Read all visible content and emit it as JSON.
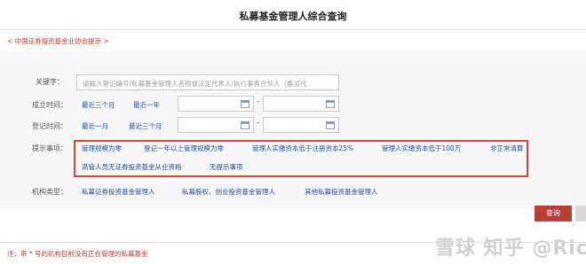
{
  "title": "私募基金管理人综合查询",
  "notice": "< 中国证券投资基金业协会提示 >",
  "keyword": {
    "label": "关键字：",
    "placeholder": "请输入登记编号/私募基金管理人名称或法定代表人/执行事务合伙人（委派代"
  },
  "established": {
    "label": "成立时间：",
    "opt1": "最近三个月",
    "opt2": "最近一年",
    "dash": "-"
  },
  "registered": {
    "label": "登记时间：",
    "opt1": "最近一月",
    "opt2": "最近三个月",
    "dash": "-"
  },
  "hints": {
    "label": "提示事项：",
    "items": [
      "管理规模为零",
      "登记一年以上管理规模为零",
      "管理人实缴资本低于注册资本25%",
      "管理人实缴资本低于100万",
      "非正常清算",
      "高管人员无证券投资基金从业资格",
      "无提示事项"
    ]
  },
  "org_type": {
    "label": "机构类型：",
    "items": [
      "私募证券投资基金管理人",
      "私募股权、创业投资基金管理人",
      "其他私募投资基金管理人"
    ]
  },
  "search_button": "查询",
  "footnote": "注：带 * 号的机构目前没有正在管理的私募基金",
  "watermark": "雪球 知乎 @Ricky"
}
